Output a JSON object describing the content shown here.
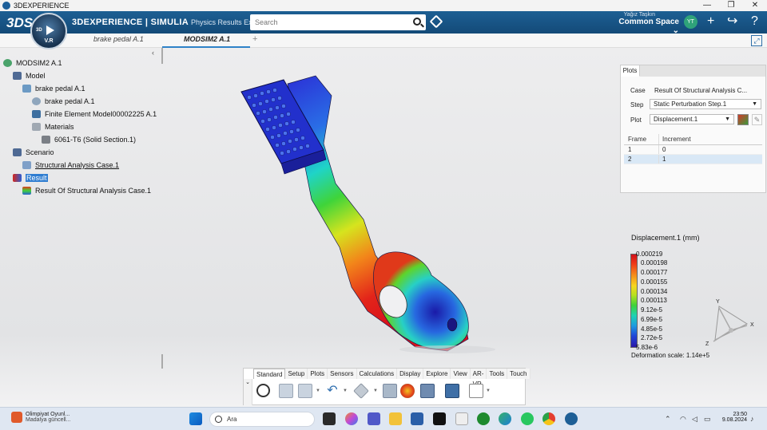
{
  "window": {
    "title": "3DEXPERIENCE",
    "minimize": "—",
    "maximize": "❐",
    "close": "✕"
  },
  "appbar": {
    "logo": "3DS",
    "compass_label": "3D",
    "compass_version": "V.R",
    "brand": "3DEXPERIENCE | SIMULIA",
    "app_name": "Physics Results Explorer",
    "search_placeholder": "Search",
    "user_name": "Yağız Taşkın",
    "space": "Common Space ⌄",
    "avatar_initials": "YT",
    "add_icon": "+",
    "share_icon": "↪",
    "help_icon": "?"
  },
  "tabs": [
    {
      "label": "brake pedal A.1"
    },
    {
      "label": "MODSIM2 A.1"
    }
  ],
  "tab_add": "+",
  "fullscreen": "⤢",
  "tree": {
    "collapse": "‹",
    "nodes": [
      {
        "label": "MODSIM2 A.1"
      },
      {
        "label": "Model"
      },
      {
        "label": "brake pedal A.1"
      },
      {
        "label": "brake pedal A.1"
      },
      {
        "label": "Finite Element Model00002225 A.1"
      },
      {
        "label": "Materials"
      },
      {
        "label": "6061-T6 (Solid Section.1)"
      },
      {
        "label": "Scenario"
      },
      {
        "label": "Structural Analysis Case.1"
      },
      {
        "label": "Result"
      },
      {
        "label": "Result Of Structural Analysis Case.1"
      }
    ]
  },
  "plots_panel": {
    "tab": "Plots",
    "case_label": "Case",
    "case_value": "Result Of Structural Analysis C...",
    "step_label": "Step",
    "step_value": "Static Perturbation Step.1",
    "plot_label": "Plot",
    "plot_value": "Displacement.1",
    "table": {
      "headers": [
        "Frame",
        "Increment"
      ],
      "rows": [
        [
          "1",
          "0"
        ],
        [
          "2",
          "1"
        ]
      ]
    }
  },
  "legend": {
    "title": "Displacement.1 (mm)",
    "values": [
      "0.000219",
      "0.000198",
      "0.000177",
      "0.000155",
      "0.000134",
      "0.000113",
      "9.12e-5",
      "6.99e-5",
      "4.85e-5",
      "2.72e-5",
      "5.83e-6"
    ],
    "deformation": "Deformation scale: 1.14e+5"
  },
  "triad": {
    "y": "Y",
    "x": "X",
    "z": "Z"
  },
  "toolbar": {
    "tabs": [
      "Standard",
      "Setup",
      "Plots",
      "Sensors",
      "Calculations",
      "Display",
      "Explore",
      "View",
      "AR-VR",
      "Tools",
      "Touch"
    ],
    "side": "⌄"
  },
  "taskbar": {
    "notif_title": "Olimpiyat Oyunl...",
    "notif_sub": "Madalya güncell...",
    "search_text": "Ara",
    "time": "23:50",
    "date": "9.08.2024",
    "tray_up": "⌃"
  }
}
